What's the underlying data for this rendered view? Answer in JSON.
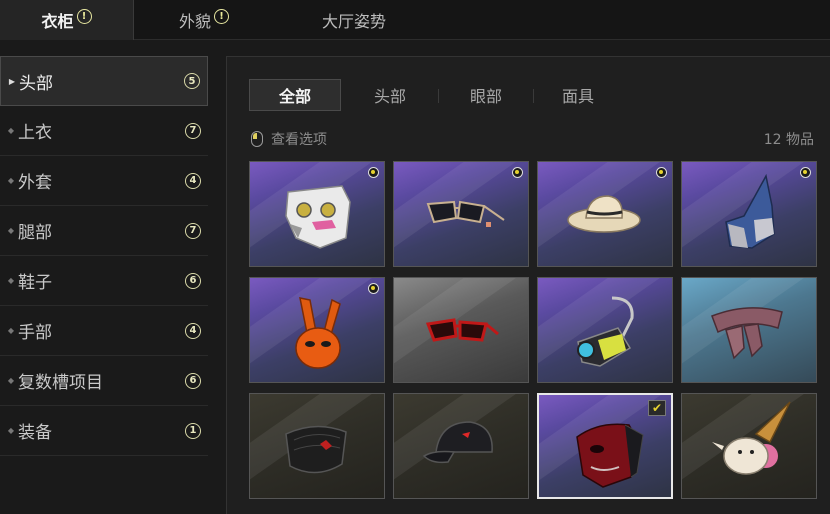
{
  "top_tabs": [
    {
      "label": "衣柜",
      "alert": "!",
      "active": true
    },
    {
      "label": "外貌",
      "alert": "!",
      "active": false
    },
    {
      "label": "大厅姿势",
      "alert": null,
      "active": false
    }
  ],
  "sidebar": {
    "items": [
      {
        "label": "头部",
        "count": "5",
        "active": true
      },
      {
        "label": "上衣",
        "count": "7"
      },
      {
        "label": "外套",
        "count": "4"
      },
      {
        "label": "腿部",
        "count": "7"
      },
      {
        "label": "鞋子",
        "count": "6"
      },
      {
        "label": "手部",
        "count": "4"
      },
      {
        "label": "复数槽项目",
        "count": "6"
      },
      {
        "label": "装备",
        "count": "1"
      }
    ]
  },
  "sub_tabs": [
    {
      "label": "全部",
      "active": true
    },
    {
      "label": "头部"
    },
    {
      "label": "眼部"
    },
    {
      "label": "面具"
    }
  ],
  "options_label": "查看选项",
  "item_count": "12 物品",
  "items": [
    {
      "name": "white-mask-icon",
      "bg": "purple",
      "badge": "new"
    },
    {
      "name": "sunglasses-icon",
      "bg": "purple",
      "badge": "new"
    },
    {
      "name": "sun-hat-icon",
      "bg": "purple",
      "badge": "new"
    },
    {
      "name": "blue-hood-icon",
      "bg": "purple",
      "badge": "new"
    },
    {
      "name": "bunny-mask-icon",
      "bg": "purple",
      "badge": "new"
    },
    {
      "name": "red-glasses-icon",
      "bg": "grey",
      "badge": null
    },
    {
      "name": "gas-mask-icon",
      "bg": "purple",
      "badge": null
    },
    {
      "name": "scarf-icon",
      "bg": "teal",
      "badge": null
    },
    {
      "name": "face-mask-icon",
      "bg": "dark",
      "badge": null
    },
    {
      "name": "baseball-cap-icon",
      "bg": "dark",
      "badge": null
    },
    {
      "name": "red-demon-mask-icon",
      "bg": "purple",
      "badge": "equipped"
    },
    {
      "name": "ice-cream-hat-icon",
      "bg": "dark",
      "badge": null
    }
  ],
  "colors": {
    "accent_yellow": "#e6d230",
    "purple_bg": "#5a4aa0"
  }
}
